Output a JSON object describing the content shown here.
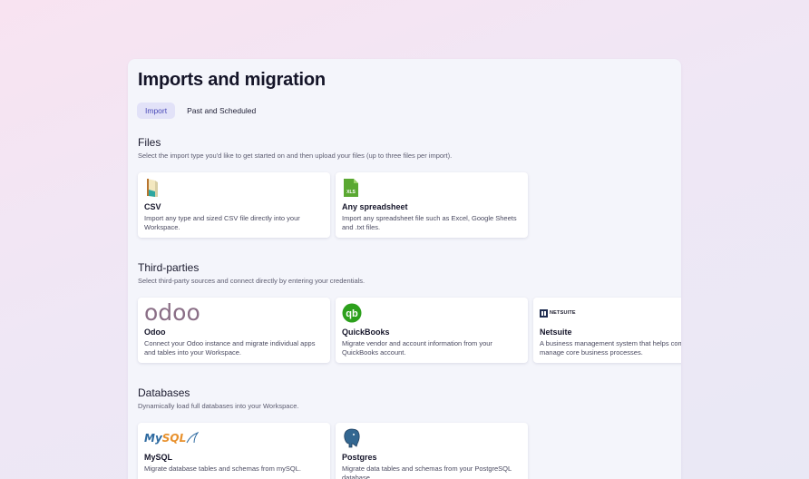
{
  "page": {
    "title": "Imports and migration",
    "tabs": [
      {
        "label": "Import",
        "active": true
      },
      {
        "label": "Past and Scheduled",
        "active": false
      }
    ]
  },
  "sections": {
    "files": {
      "title": "Files",
      "description": "Select the import type you'd like to get started on and then upload your files (up to three files per import).",
      "cards": [
        {
          "name": "CSV",
          "description": "Import any type and sized CSV file directly into your Workspace.",
          "icon": "csv-file-icon"
        },
        {
          "name": "Any spreadsheet",
          "description": "Import any spreadsheet file such as Excel, Google Sheets and .txt files.",
          "icon": "spreadsheet-xls-icon",
          "icon_text": "XLS"
        }
      ]
    },
    "third_parties": {
      "title": "Third-parties",
      "description": "Select third-party sources and connect directly by entering your credentials.",
      "cards": [
        {
          "name": "Odoo",
          "description": "Connect your Odoo instance and migrate individual apps and tables into your Workspace.",
          "logo_text": "odoo"
        },
        {
          "name": "QuickBooks",
          "description": "Migrate vendor and account information from your QuickBooks account.",
          "icon": "quickbooks-logo"
        },
        {
          "name": "Netsuite",
          "description": "A business management system that helps companies manage core business processes.",
          "logo_text": "NETSUITE"
        }
      ]
    },
    "databases": {
      "title": "Databases",
      "description": "Dynamically load full databases into your Workspace.",
      "cards": [
        {
          "name": "MySQL",
          "description": "Migrate database tables and schemas from mySQL.",
          "logo_text_a": "My",
          "logo_text_b": "SQL"
        },
        {
          "name": "Postgres",
          "description": "Migrate data tables and schemas from your PostgreSQL database.",
          "icon": "postgres-elephant-logo"
        }
      ]
    }
  },
  "colors": {
    "accent": "#4a4ab8",
    "tab_active_bg": "#e2e2f8",
    "quickbooks_green": "#2ca01c",
    "xls_green": "#5aa832",
    "postgres_blue": "#336791"
  }
}
